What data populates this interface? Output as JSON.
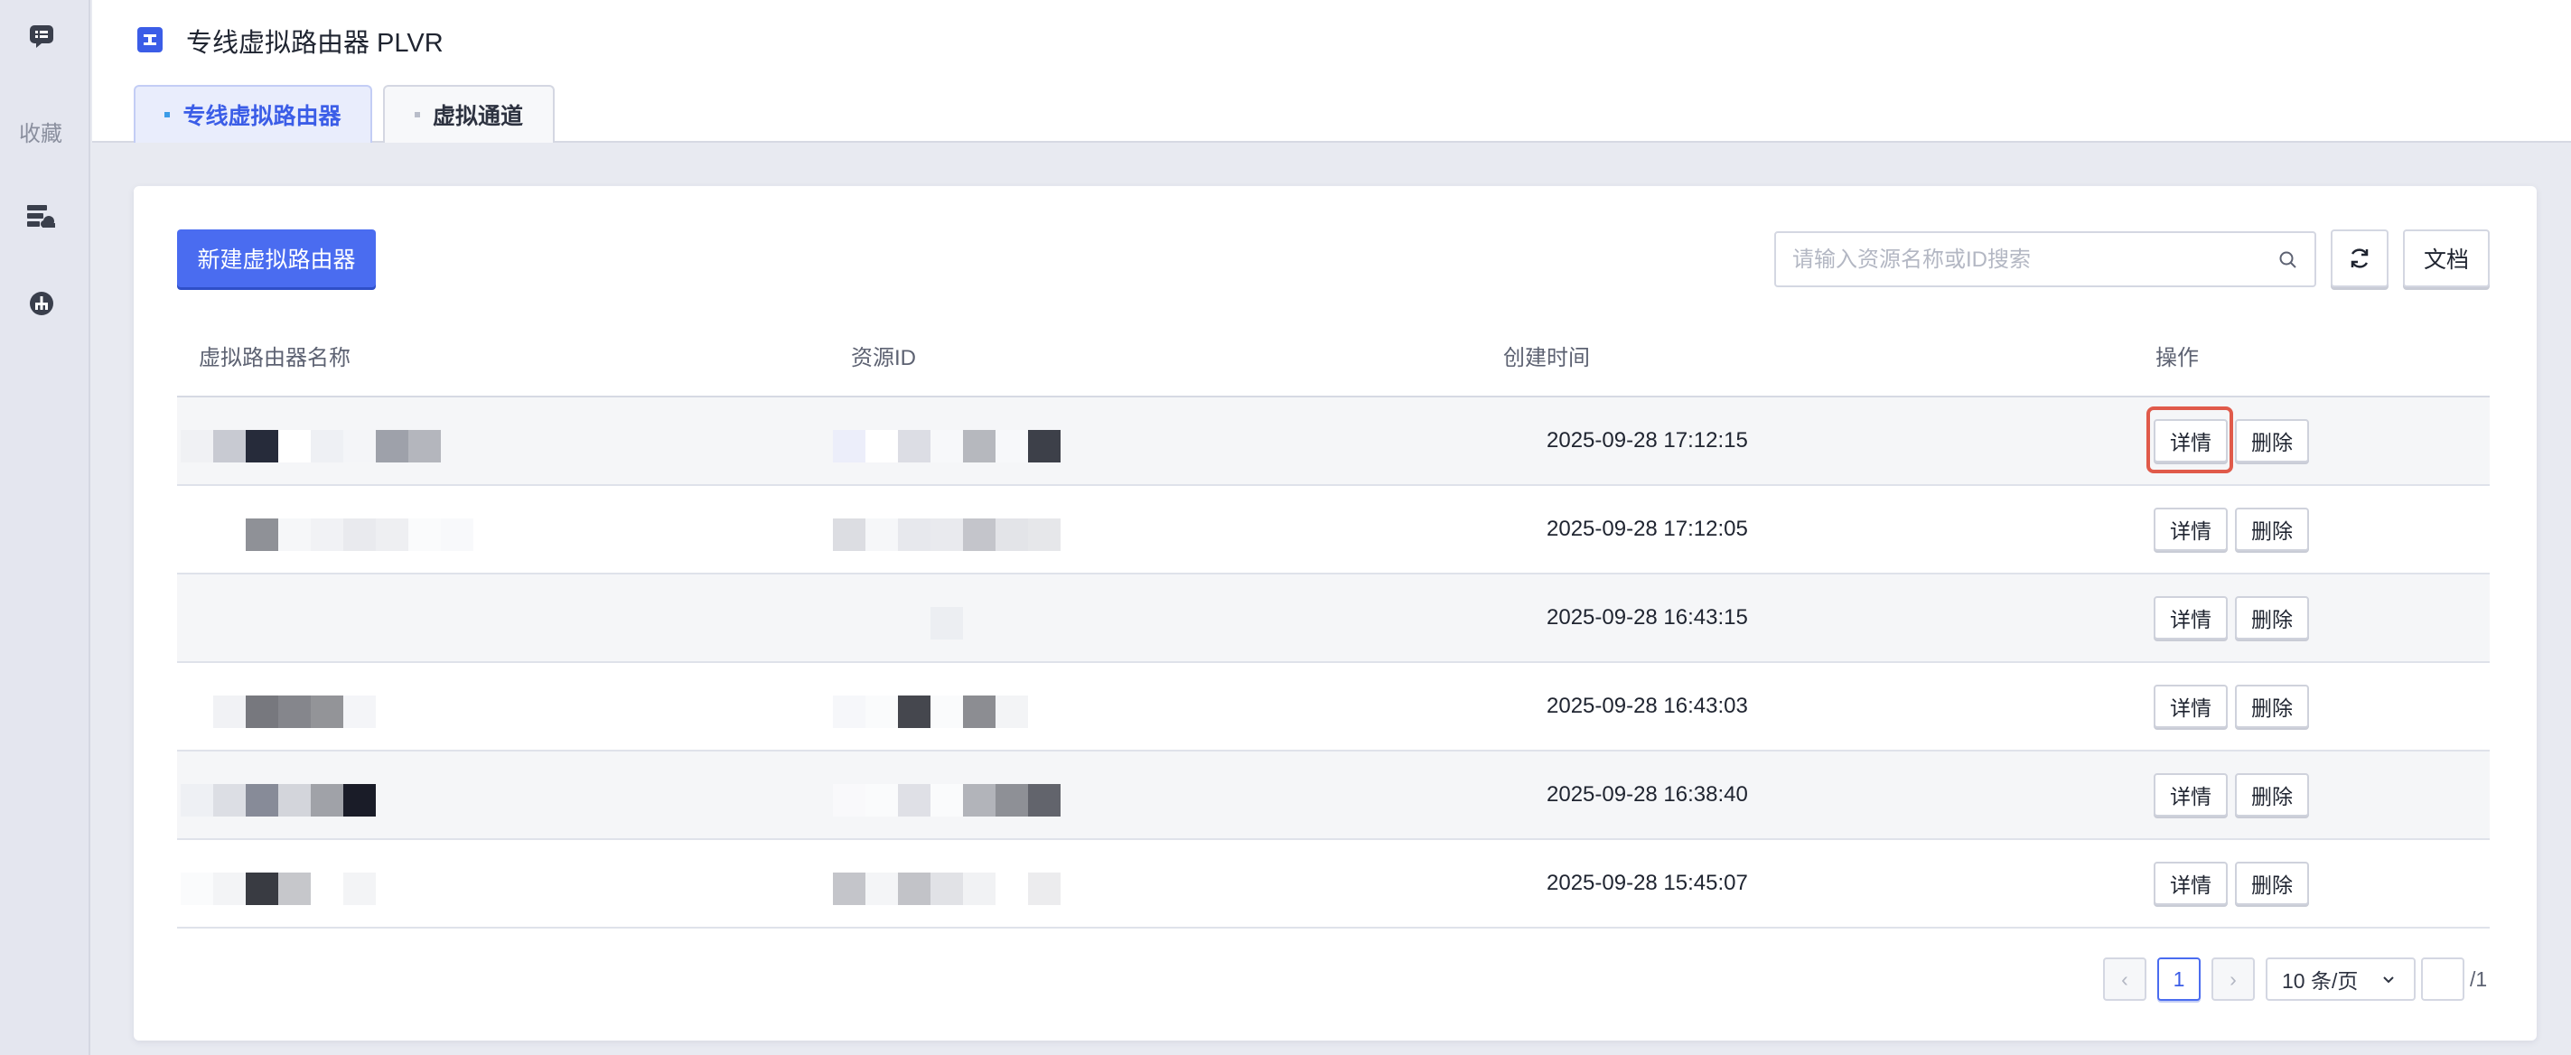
{
  "sidebar": {
    "favorites_label": "收藏"
  },
  "header": {
    "title": "专线虚拟路由器 PLVR",
    "tabs": [
      {
        "label": "专线虚拟路由器"
      },
      {
        "label": "虚拟通道"
      }
    ]
  },
  "toolbar": {
    "create_label": "新建虚拟路由器",
    "search_placeholder": "请输入资源名称或ID搜索",
    "docs_label": "文档"
  },
  "table": {
    "columns": [
      "虚拟路由器名称",
      "资源ID",
      "创建时间",
      "操作"
    ],
    "rows": [
      {
        "created": "2025-09-28 17:12:15",
        "detail": "详情",
        "delete": "删除"
      },
      {
        "created": "2025-09-28 17:12:05",
        "detail": "详情",
        "delete": "删除"
      },
      {
        "created": "2025-09-28 16:43:15",
        "detail": "详情",
        "delete": "删除"
      },
      {
        "created": "2025-09-28 16:43:03",
        "detail": "详情",
        "delete": "删除"
      },
      {
        "created": "2025-09-28 16:38:40",
        "detail": "详情",
        "delete": "删除"
      },
      {
        "created": "2025-09-28 15:45:07",
        "detail": "详情",
        "delete": "删除"
      }
    ]
  },
  "pagination": {
    "current_page": "1",
    "page_size": "10 条/页",
    "total": "/1"
  },
  "colors": {
    "accent": "#4a6cf0",
    "highlight": "#e05a4a"
  }
}
